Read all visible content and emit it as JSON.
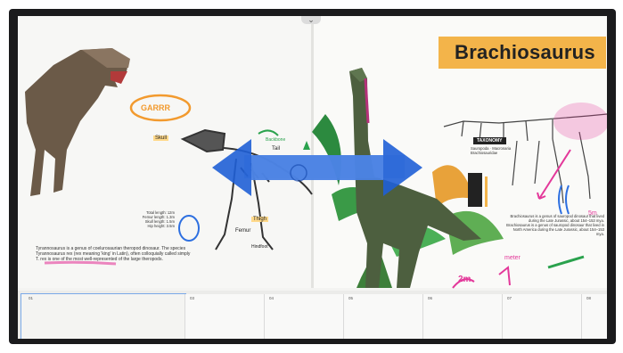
{
  "canvas": {
    "title": "Brachiosaurus",
    "collapse_glyph": "⌄",
    "left_page": {
      "annotations": {
        "garrr": "GARRR",
        "skull": "Skull",
        "tail": "Tail",
        "backbone": "Backbone",
        "thigh": "Thigh",
        "femur": "Femur",
        "foot": "Hindfoot"
      },
      "stats": [
        "Total length: 12m",
        "Femur length: 1.3m",
        "Skull length: 1.5m",
        "Hip height: 3.5m"
      ],
      "description": "Tyrannosaurus is a genus of coelurosaurian theropod dinosaur. The species Tyrannosaurus rex (rex meaning 'king' in Latin), often colloquially called simply T. rex is one of the most well-represented of the large theropods."
    },
    "right_page": {
      "taxonomy_label": "TAXONOMY",
      "taxonomy_lines": [
        "Sauropoda · Macronaria",
        "Brachiosauridae"
      ],
      "description": "Brachiosaurus is a genus of sauropod dinosaur that lived during the Late Jurassic, about 154–153 mya. Brachiosaurus is a genus of sauropod dinosaur that lived in North America during the Late Jurassic, about 154–153 mya.",
      "handwriting": [
        "2m",
        "5m",
        "meter"
      ]
    },
    "gesture": {
      "type": "two-way swipe arrow",
      "icon": "double-arrow-icon"
    }
  },
  "thumbnail_tray": {
    "pages": [
      {
        "number": "01",
        "active": true,
        "tag": "Brachiosaurus"
      },
      {
        "number": "02",
        "active": false
      },
      {
        "number": "03",
        "active": false
      },
      {
        "number": "04",
        "active": false
      },
      {
        "number": "05",
        "active": false
      },
      {
        "number": "06",
        "active": false
      },
      {
        "number": "07",
        "active": false
      },
      {
        "number": "08",
        "active": false
      }
    ],
    "pointer": "hand-cursor-icon"
  },
  "colors": {
    "bezel": "#1b1b1d",
    "title_band": "#f3b44a",
    "arrow": "#1f5fd6",
    "highlight_pink": "#e3389a",
    "tag_green": "#4cc06c"
  }
}
